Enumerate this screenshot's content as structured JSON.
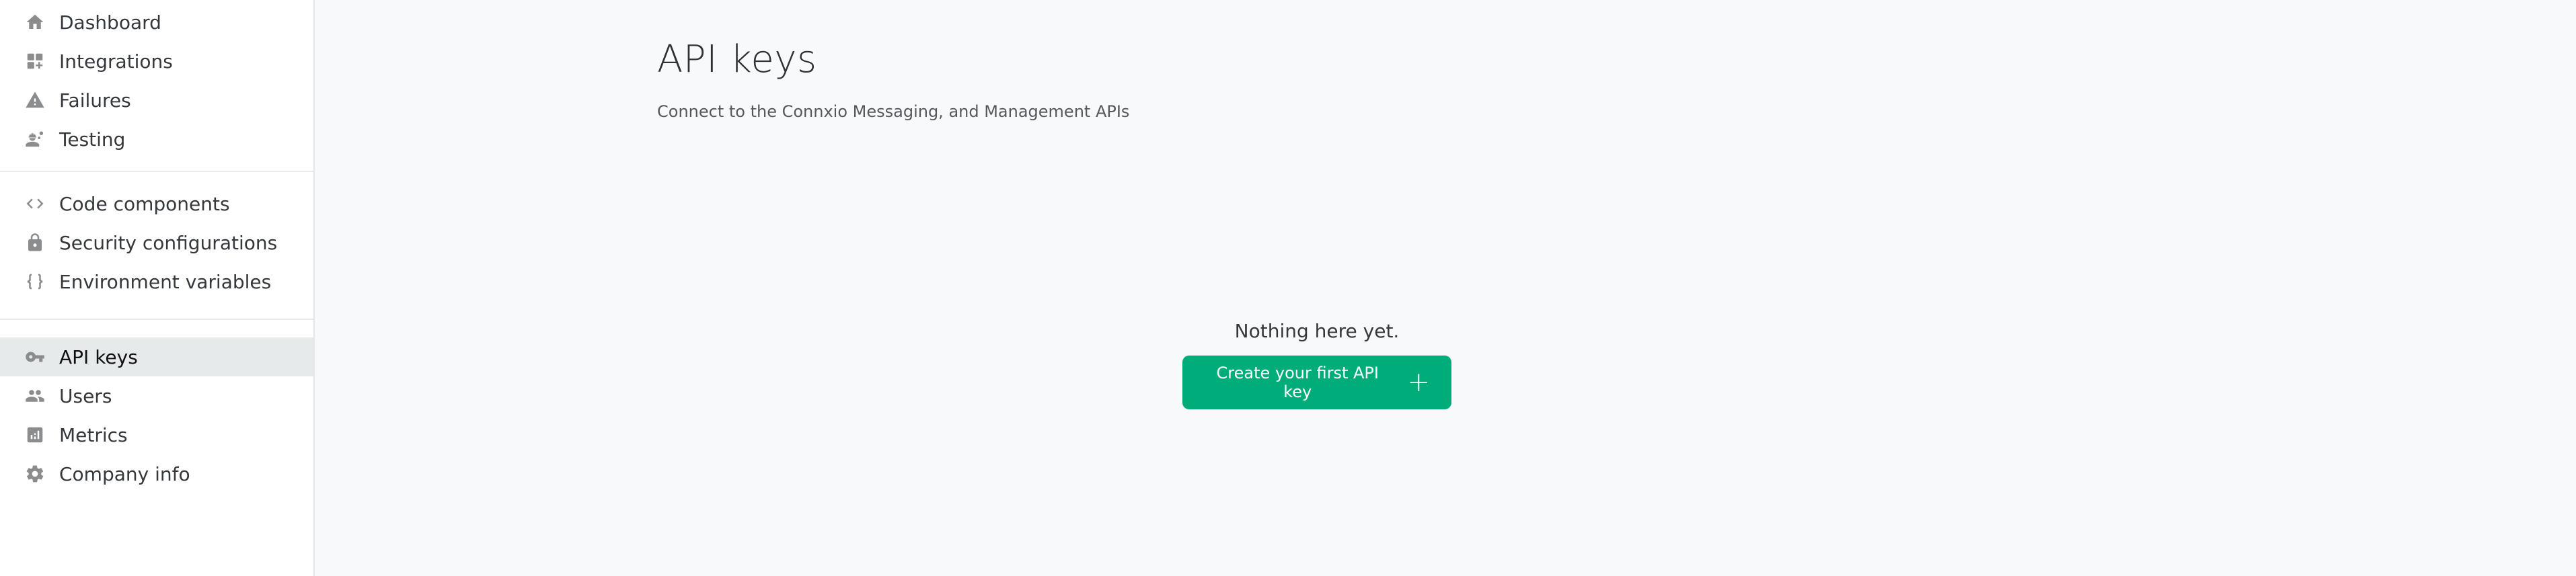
{
  "sidebar": {
    "groups": [
      {
        "items": [
          {
            "label": "Dashboard",
            "icon": "home-icon"
          },
          {
            "label": "Integrations",
            "icon": "widgets-add-icon"
          },
          {
            "label": "Failures",
            "icon": "warning-icon"
          },
          {
            "label": "Testing",
            "icon": "engineer-icon"
          }
        ]
      },
      {
        "items": [
          {
            "label": "Code components",
            "icon": "code-icon"
          },
          {
            "label": "Security configurations",
            "icon": "lock-icon"
          },
          {
            "label": "Environment variables",
            "icon": "braces-icon"
          }
        ]
      },
      {
        "items": [
          {
            "label": "API keys",
            "icon": "key-icon",
            "active": true
          },
          {
            "label": "Users",
            "icon": "users-icon"
          },
          {
            "label": "Metrics",
            "icon": "bar-chart-icon"
          },
          {
            "label": "Company info",
            "icon": "gear-icon"
          }
        ]
      }
    ]
  },
  "main": {
    "title": "API keys",
    "subtitle": "Connect to the Connxio Messaging, and Management APIs",
    "empty_state": {
      "message": "Nothing here yet.",
      "button_label": "Create your first API key",
      "button_icon": "plus-icon"
    }
  },
  "colors": {
    "accent": "#00ad7a",
    "active_nav_bg": "#e6eaea",
    "icon_gray": "#8a8c8e",
    "page_bg": "#f8f9fa"
  }
}
